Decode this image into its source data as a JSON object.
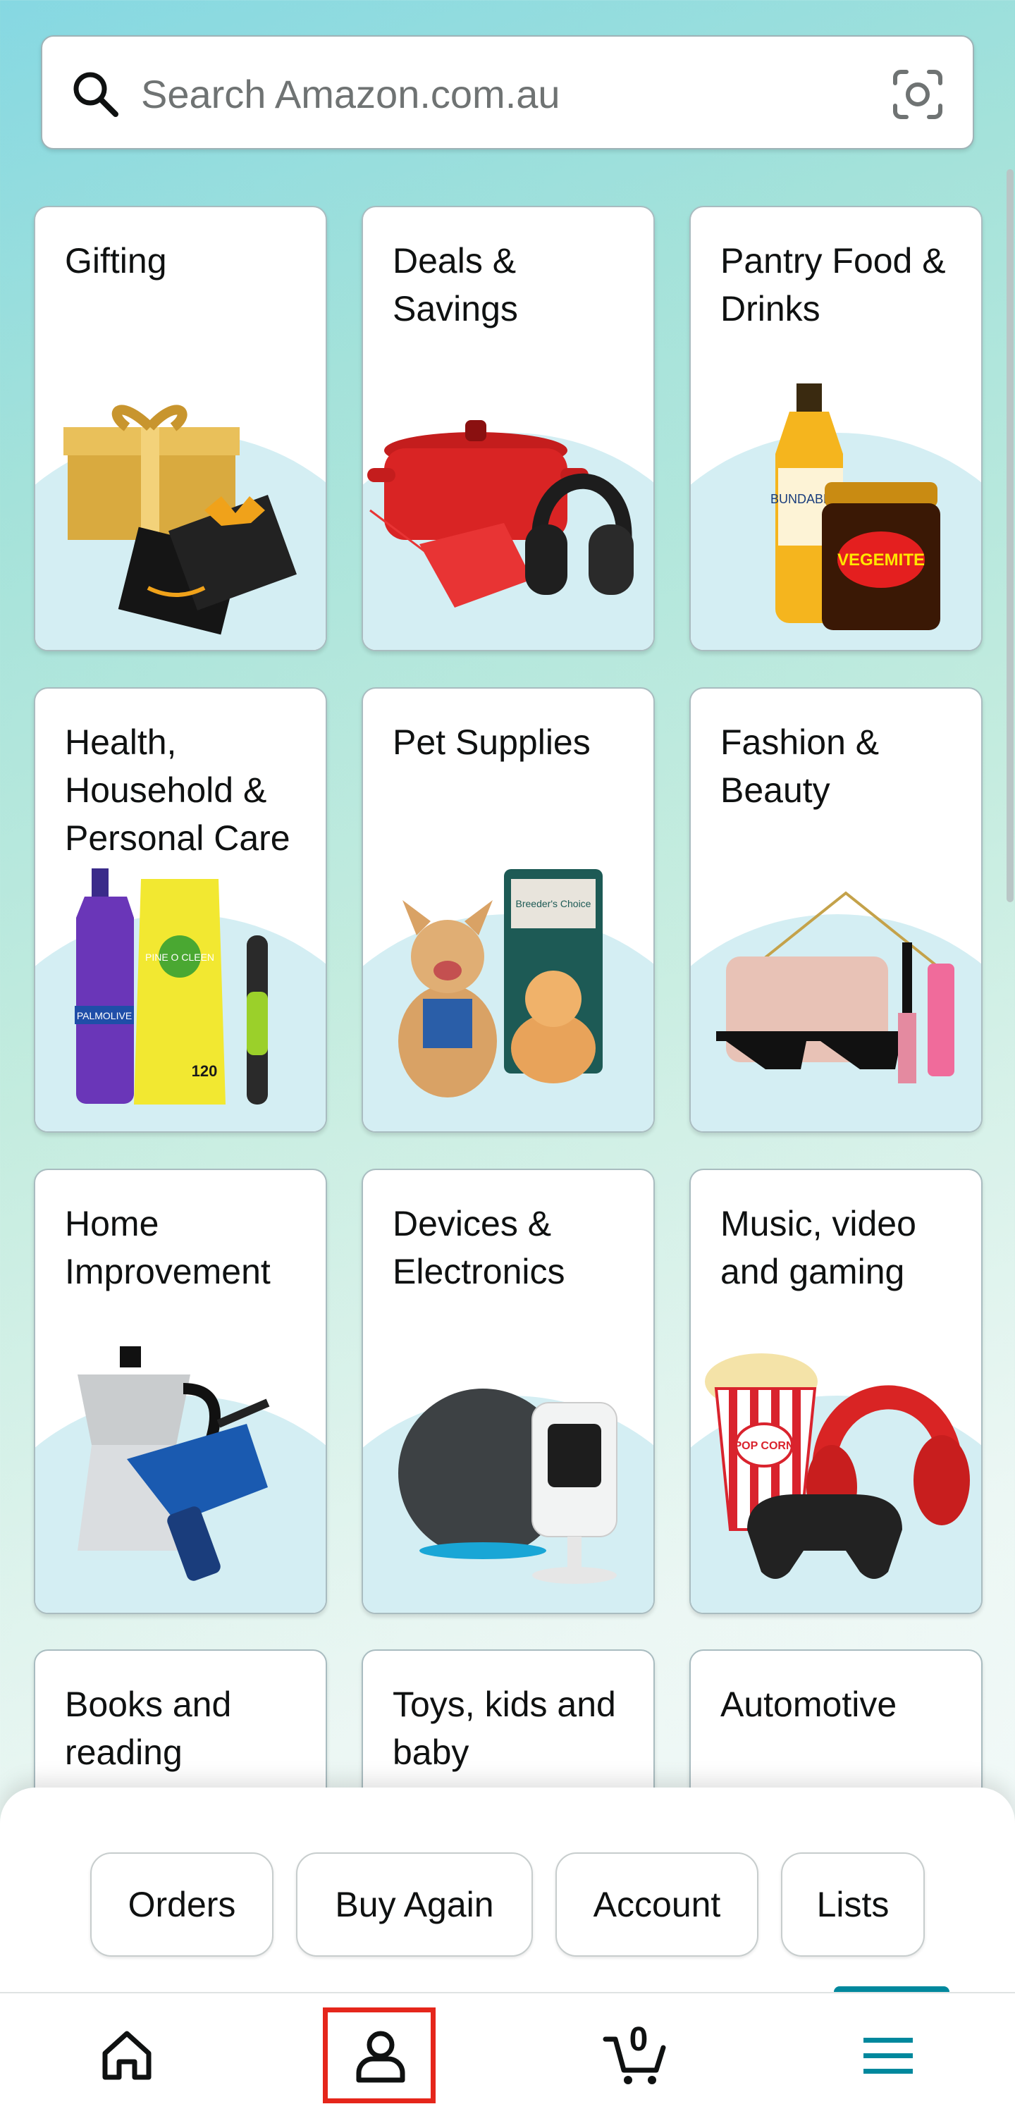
{
  "search": {
    "placeholder": "Search Amazon.com.au",
    "icon": "search-icon",
    "camera_icon": "camera-scan-icon"
  },
  "categories": [
    {
      "label": "Gifting"
    },
    {
      "label": "Deals & Savings"
    },
    {
      "label": "Pantry Food & Drinks"
    },
    {
      "label": "Health, Household & Personal Care"
    },
    {
      "label": "Pet Supplies"
    },
    {
      "label": "Fashion & Beauty"
    },
    {
      "label": "Home Improvement"
    },
    {
      "label": "Devices & Electronics"
    },
    {
      "label": "Music, video and gaming"
    },
    {
      "label": "Books and reading"
    },
    {
      "label": "Toys, kids and baby"
    },
    {
      "label": "Automotive"
    }
  ],
  "quick_links": [
    "Orders",
    "Buy Again",
    "Account",
    "Lists"
  ],
  "nav": {
    "home_icon": "home-icon",
    "account_icon": "person-icon",
    "cart_icon": "cart-icon",
    "cart_count": "0",
    "menu_icon": "menu-icon",
    "active_color": "#00889d",
    "highlight_color": "#e5261b"
  },
  "product_text": {
    "bundaberg": "BUNDABERG",
    "vegemite": "VEGEMITE",
    "palmolive": "PALMOLIVE",
    "pine": "PINE O CLEEN",
    "wipes": "120",
    "breeders": "Breeder's Choice",
    "popcorn": "POP CORN"
  }
}
